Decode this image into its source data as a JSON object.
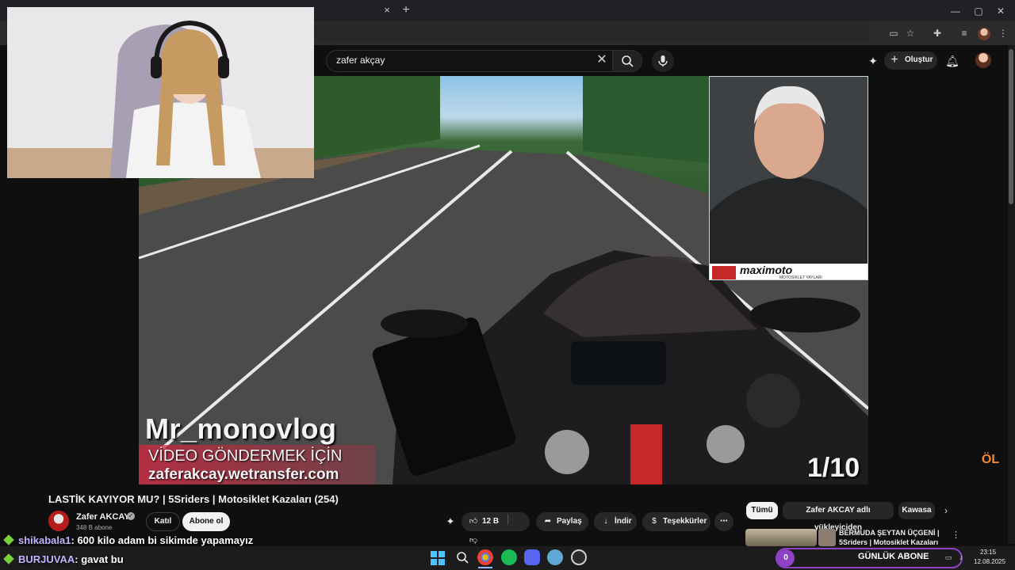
{
  "browser": {
    "tab_close_icon": "×",
    "new_tab_icon": "+",
    "window_controls": [
      "—",
      "▢",
      "✕"
    ]
  },
  "youtube": {
    "search": {
      "query": "zafer akçay"
    },
    "create_label": "Oluştur",
    "video": {
      "overlay_channel": "Mr_monovlog",
      "overlay_banner_line1": "VİDEO GÖNDERMEK İÇİN",
      "overlay_banner_line2": "zaferakcay.wetransfer.com",
      "overlay_counter": "1/10",
      "inset_brand": "maximoto",
      "inset_brand_sub": "MOTOSİKLET YAYLARI"
    },
    "title": "LASTİK KAYIYOR MU? | 5Sriders | Motosiklet Kazaları (254)",
    "channel": {
      "name": "Zafer AKCAY",
      "subscribers": "348 B abone",
      "join_label": "Katıl",
      "subscribe_label": "Abone ol"
    },
    "actions": {
      "likes": "12 B",
      "share": "Paylaş",
      "download": "İndir",
      "thanks": "Teşekkürler"
    },
    "chips": [
      "Tümü",
      "Zafer AKCAY adlı yükleyiciden",
      "Kawasa"
    ],
    "recommendation": {
      "title_line1": "BERMUDA ŞEYTAN ÜÇGENİ |",
      "title_line2": "5Sriders | Motosiklet Kazaları"
    },
    "side_logo": "ÖL"
  },
  "chat": [
    {
      "user": "shikabala1",
      "message": ": 600 kilo adam bi sikimde yapamayız"
    },
    {
      "user": "BURJUVAA",
      "message": ": gavat bu"
    }
  ],
  "taskbar": {
    "sub_goal_count": "0",
    "sub_goal_label": "GÜNLÜK ABONE",
    "time": "23:15",
    "date": "12.08.2025"
  },
  "colors": {
    "yt_bg": "#0f0f0f",
    "accent_red": "#d62540",
    "chat_name": "#c3b4ff",
    "goal_purple": "#8e43c6"
  }
}
